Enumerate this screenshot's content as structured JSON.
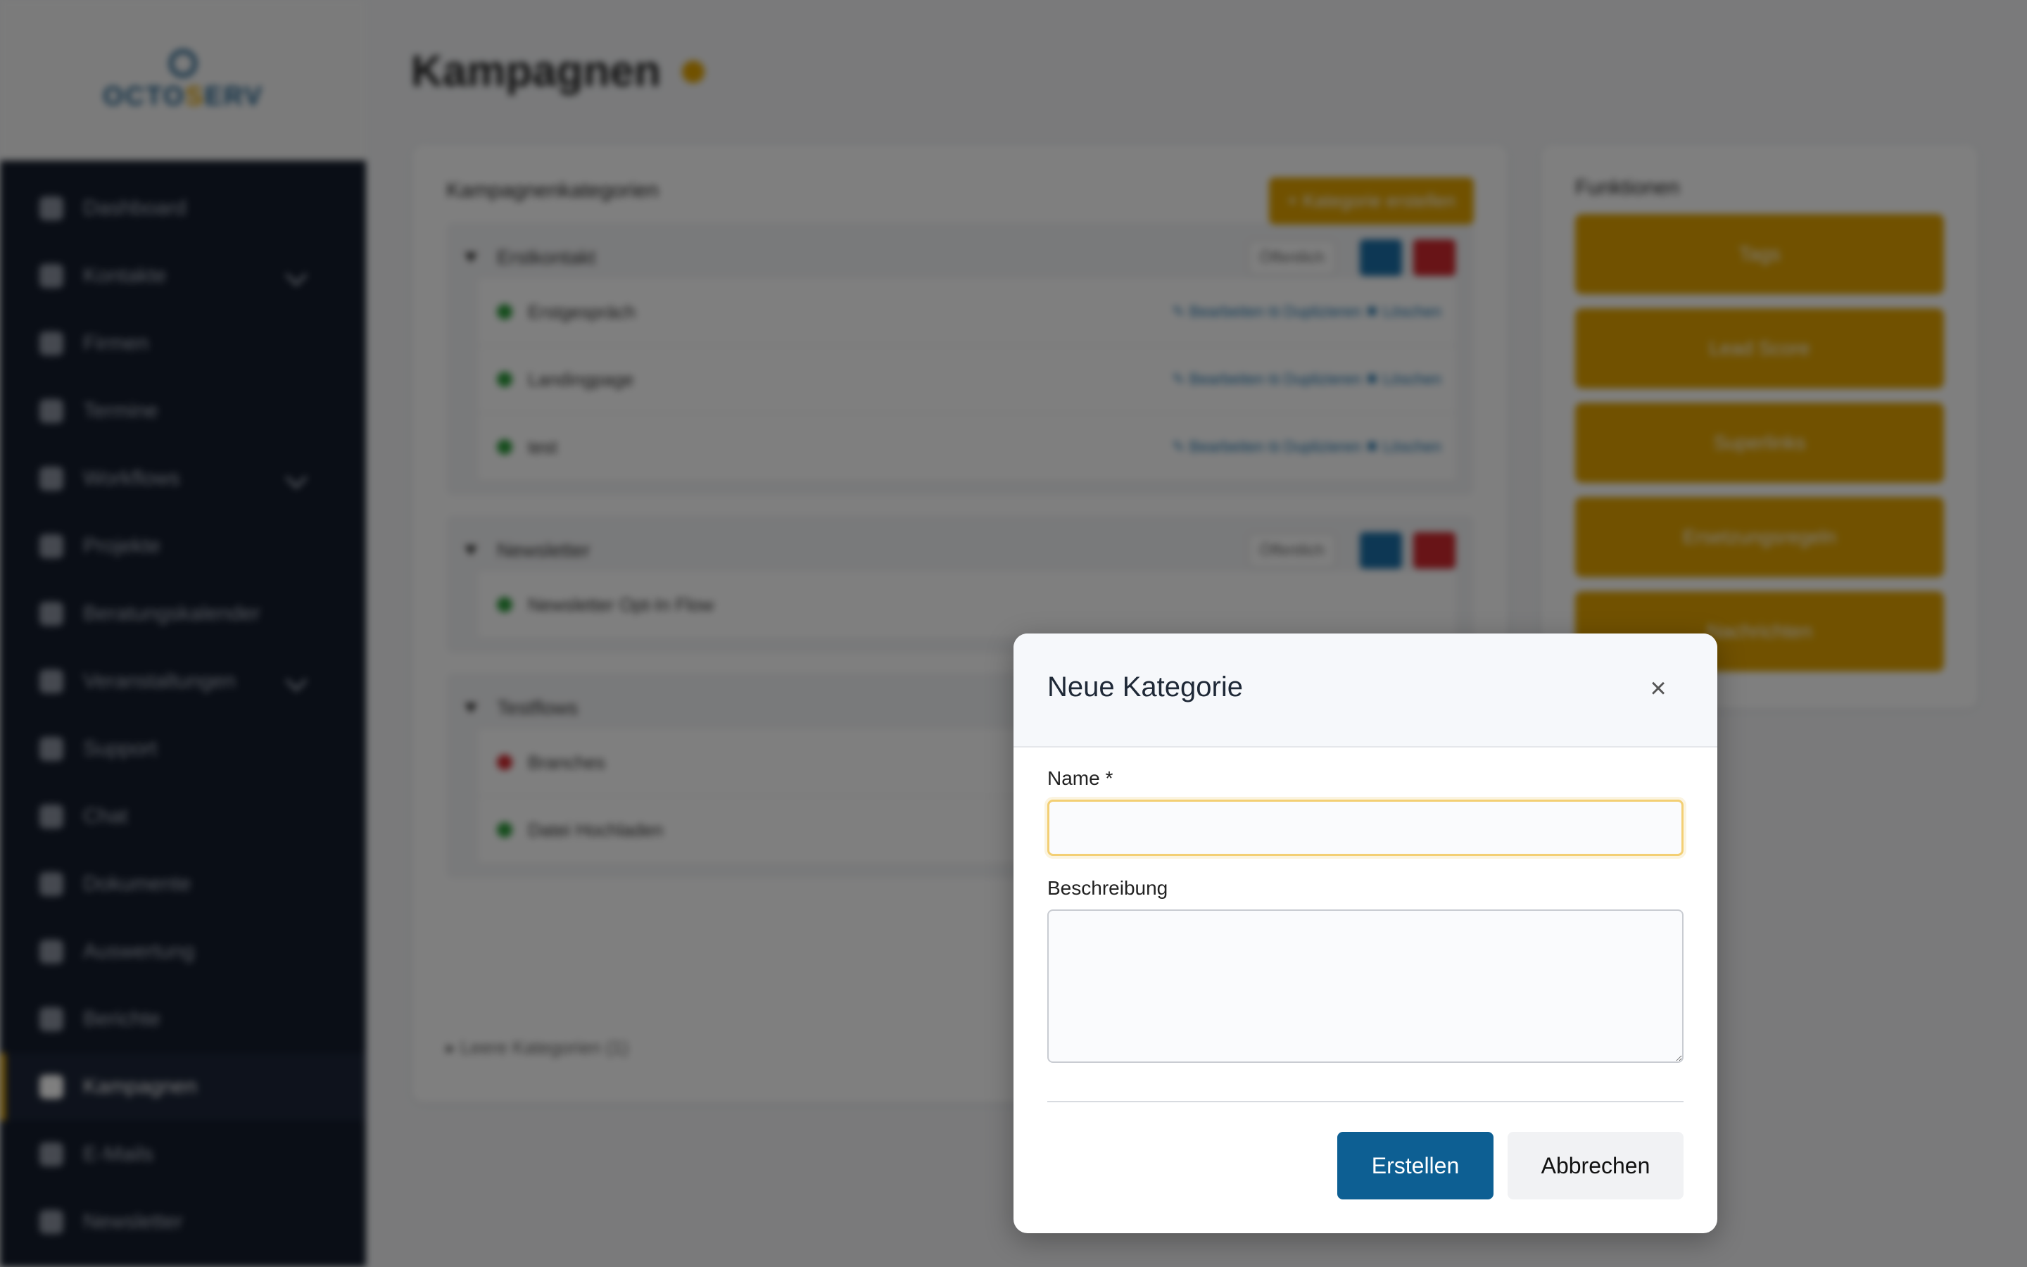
{
  "app": {
    "logo_text_a": "OCTO",
    "logo_text_b": "S",
    "logo_text_c": "ERV"
  },
  "sidebar": {
    "items": [
      {
        "label": "Dashboard",
        "icon": "dashboard-icon"
      },
      {
        "label": "Kontakte",
        "icon": "contacts-icon"
      },
      {
        "label": "Firmen",
        "icon": "building-icon"
      },
      {
        "label": "Termine",
        "icon": "calendar-icon"
      },
      {
        "label": "Workflows",
        "icon": "shuffle-icon"
      },
      {
        "label": "Projekte",
        "icon": "tag-icon"
      },
      {
        "label": "Beratungskalender",
        "icon": "clock-icon"
      },
      {
        "label": "Veranstaltungen",
        "icon": "event-icon"
      },
      {
        "label": "Support",
        "icon": "support-icon"
      },
      {
        "label": "Chat",
        "icon": "chat-icon"
      },
      {
        "label": "Dokumente",
        "icon": "document-icon"
      },
      {
        "label": "Auswertung",
        "icon": "bar-chart-icon"
      },
      {
        "label": "Berichte",
        "icon": "line-chart-icon"
      },
      {
        "label": "Kampagnen",
        "icon": "megaphone-icon"
      },
      {
        "label": "E-Mails",
        "icon": "mail-icon"
      },
      {
        "label": "Newsletter",
        "icon": "megaphone-icon"
      }
    ]
  },
  "main": {
    "title": "Kampagnen",
    "categories_title": "Kampagnenkategorien",
    "create_category_label": "+ Kategorie erstellen",
    "public_label": "Öffentlich",
    "groups": [
      {
        "name": "Erstkontakt",
        "flows": [
          "Erstgespräch",
          "Landingpage",
          "test"
        ]
      },
      {
        "name": "Newsletter",
        "flows": [
          "Newsletter Opt-In Flow"
        ]
      },
      {
        "name": "Testflows",
        "flows": [
          "Branches",
          "Datei Hochladen"
        ]
      }
    ],
    "flow_actions": "✎ Bearbeiten   ⧉ Duplizieren   ✖ Löschen",
    "empty_categories": "▸ Leere Kategorien (1)",
    "functions_title": "Funktionen",
    "functions": [
      "Tags",
      "Lead Score",
      "Superlinks",
      "Ersetzungsregeln",
      "Nachrichten"
    ]
  },
  "modal": {
    "title": "Neue Kategorie",
    "close_symbol": "×",
    "name_label": "Name *",
    "name_value": "",
    "description_label": "Beschreibung",
    "description_value": "",
    "create_label": "Erstellen",
    "cancel_label": "Abbrechen"
  }
}
